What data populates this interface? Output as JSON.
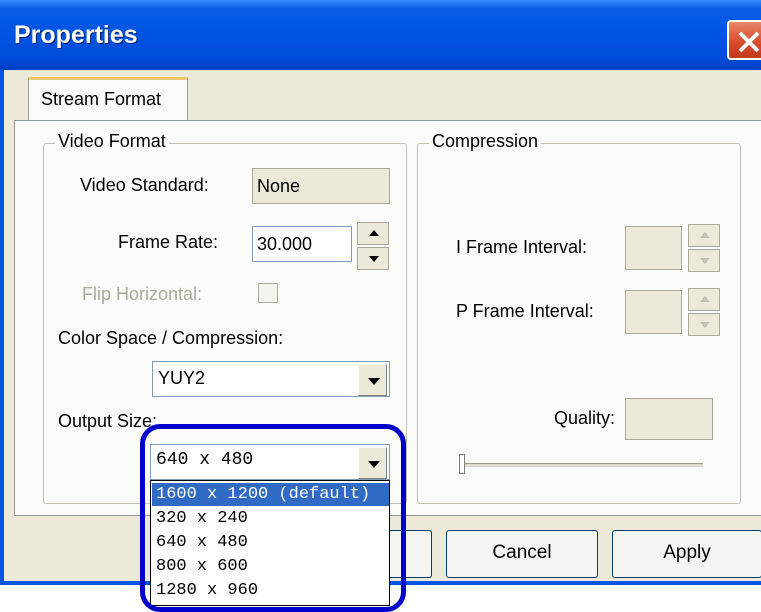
{
  "window": {
    "title": "Properties"
  },
  "tabs": [
    {
      "label": "Stream Format"
    }
  ],
  "video_format": {
    "group_label": "Video Format",
    "video_standard_label": "Video Standard:",
    "video_standard_value": "None",
    "frame_rate_label": "Frame Rate:",
    "frame_rate_value": "30.000",
    "flip_horizontal_label": "Flip Horizontal:",
    "color_space_label": "Color Space / Compression:",
    "color_space_value": "YUY2",
    "output_size_label": "Output Size:",
    "output_size_value": "640 x 480",
    "output_size_options": [
      "1600 x 1200  (default)",
      "320 x 240",
      "640 x 480",
      "800 x 600",
      "1280 x 960"
    ]
  },
  "compression": {
    "group_label": "Compression",
    "i_frame_label": "I Frame Interval:",
    "p_frame_label": "P Frame Interval:",
    "quality_label": "Quality:"
  },
  "buttons": {
    "cancel": "Cancel",
    "apply": "Apply"
  },
  "colors": {
    "titlebar": "#0054e3",
    "dialog": "#ece9d8",
    "selection": "#316ac5",
    "highlight_ring": "#0000cc"
  }
}
